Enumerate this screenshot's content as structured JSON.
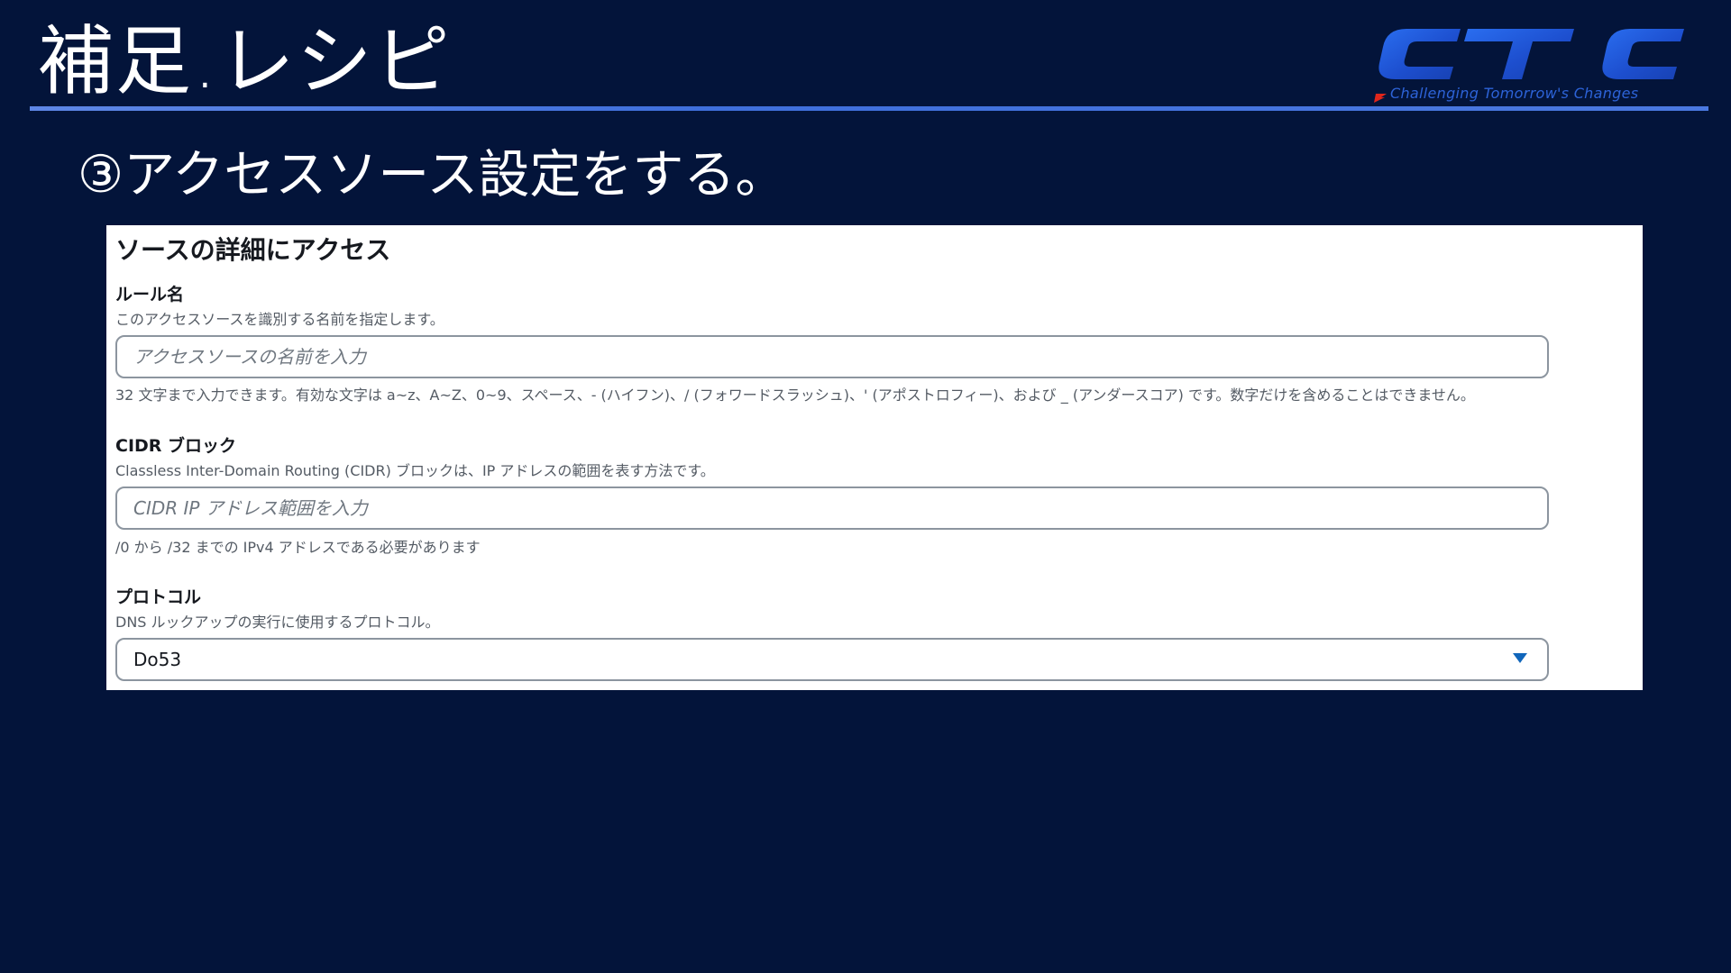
{
  "slide": {
    "title": "補足.レシピ",
    "subtitle": "③アクセスソース設定をする。"
  },
  "logo": {
    "text": "CTC",
    "tagline": "Challenging Tomorrow's Changes",
    "color": "#1f5ad6"
  },
  "panel": {
    "title": "ソースの詳細にアクセス",
    "rule_name": {
      "label": "ルール名",
      "description": "このアクセスソースを識別する名前を指定します。",
      "placeholder": "アクセスソースの名前を入力",
      "hint": "32 文字まで入力できます。有効な文字は a~z、A~Z、0~9、スペース、- (ハイフン)、/ (フォワードスラッシュ)、' (アポストロフィー)、および _ (アンダースコア) です。数字だけを含めることはできません。"
    },
    "cidr": {
      "label": "CIDR ブロック",
      "description": "Classless Inter-Domain Routing (CIDR) ブロックは、IP アドレスの範囲を表す方法です。",
      "placeholder": "CIDR IP アドレス範囲を入力",
      "hint": "/0 から /32 までの IPv4 アドレスである必要があります"
    },
    "protocol": {
      "label": "プロトコル",
      "description": "DNS ルックアップの実行に使用するプロトコル。",
      "selected": "Do53"
    }
  },
  "colors": {
    "background": "#03143a",
    "accent_rule": "#4a78e0",
    "select_caret": "#1166bb"
  }
}
